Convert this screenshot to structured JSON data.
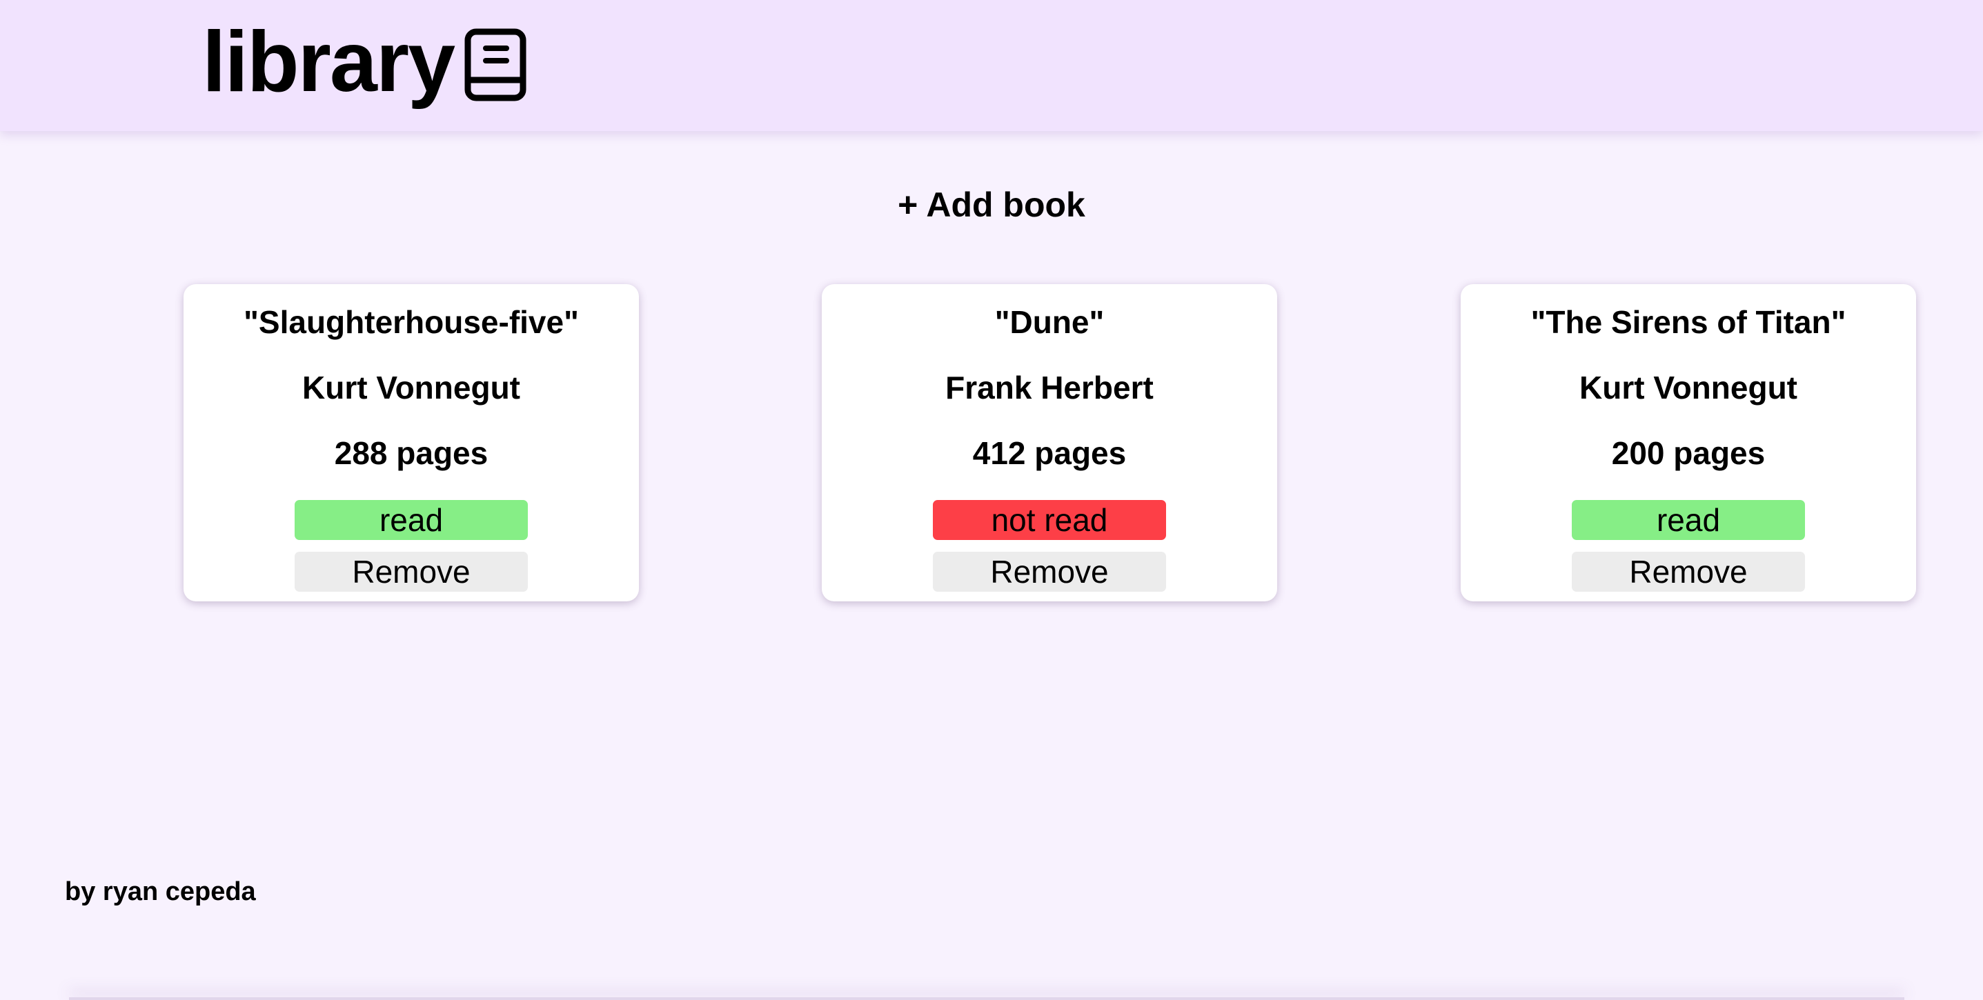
{
  "header": {
    "logo_text": "library",
    "logo_icon": "book-icon"
  },
  "actions": {
    "add_book_label": "+ Add book"
  },
  "books": [
    {
      "title": "\"Slaughterhouse-five\"",
      "author": "Kurt Vonnegut",
      "pages": "288 pages",
      "status": "read",
      "remove_label": "Remove"
    },
    {
      "title": "\"Dune\"",
      "author": "Frank Herbert",
      "pages": "412 pages",
      "status": "not read",
      "remove_label": "Remove"
    },
    {
      "title": "\"The Sirens of Titan\"",
      "author": "Kurt Vonnegut",
      "pages": "200 pages",
      "status": "read",
      "remove_label": "Remove"
    }
  ],
  "footer": {
    "credit": "by ryan cepeda"
  },
  "colors": {
    "header_bg": "#f1e3fe",
    "page_bg": "#f8f2fe",
    "read": "#86ee86",
    "not_read": "#fd3f47",
    "remove": "#ececec"
  }
}
